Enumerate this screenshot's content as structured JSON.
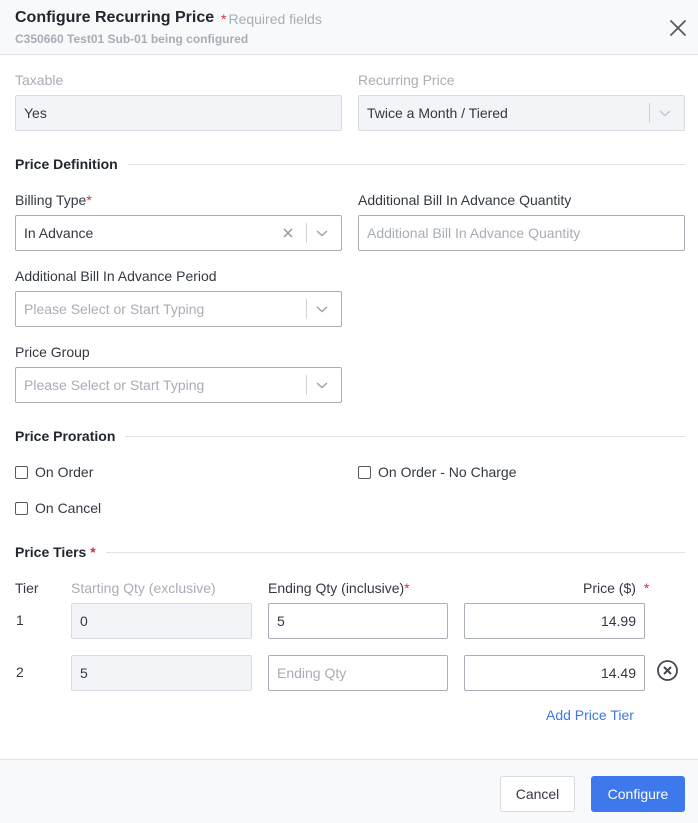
{
  "header": {
    "title": "Configure Recurring Price",
    "required_star": "*",
    "required_note": "Required fields",
    "subtitle": "C350660 Test01 Sub-01 being configured",
    "close_icon": "close-icon"
  },
  "top": {
    "taxable": {
      "label": "Taxable",
      "value": "Yes"
    },
    "recurring_price": {
      "label": "Recurring Price",
      "value": "Twice a Month / Tiered"
    }
  },
  "price_definition": {
    "title": "Price Definition",
    "billing_type": {
      "label": "Billing Type",
      "required": "*",
      "value": "In Advance"
    },
    "additional_qty": {
      "label": "Additional Bill In Advance Quantity",
      "placeholder": "Additional Bill In Advance Quantity"
    },
    "additional_period": {
      "label": "Additional Bill In Advance Period",
      "placeholder": "Please Select or Start Typing"
    },
    "price_group": {
      "label": "Price Group",
      "placeholder": "Please Select or Start Typing"
    }
  },
  "price_proration": {
    "title": "Price Proration",
    "options": [
      {
        "label": "On Order",
        "checked": false
      },
      {
        "label": "On Order - No Charge",
        "checked": false
      },
      {
        "label": "On Cancel",
        "checked": false
      }
    ]
  },
  "price_tiers": {
    "title": "Price Tiers",
    "required": "*",
    "columns": {
      "tier": "Tier",
      "starting": "Starting Qty (exclusive)",
      "ending": "Ending Qty (inclusive)",
      "ending_required": "*",
      "price": "Price ($)",
      "price_required": "*"
    },
    "rows": [
      {
        "tier": "1",
        "starting": "0",
        "ending": "5",
        "ending_placeholder": "Ending Qty",
        "price": "14.99"
      },
      {
        "tier": "2",
        "starting": "5",
        "ending": "",
        "ending_placeholder": "Ending Qty",
        "price": "14.49"
      }
    ],
    "add_label": "Add Price Tier"
  },
  "footer": {
    "cancel": "Cancel",
    "configure": "Configure"
  }
}
